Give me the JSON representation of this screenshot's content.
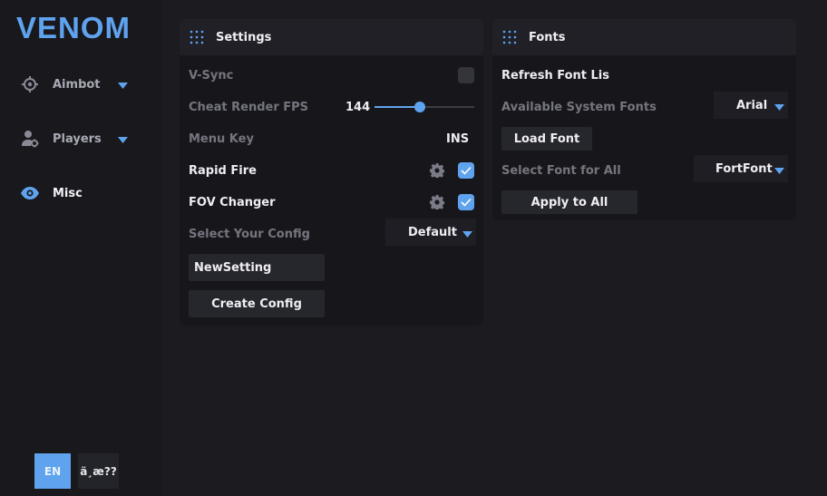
{
  "brand": {
    "name": "VENOM",
    "accent": "#5fa3ee"
  },
  "nav": [
    {
      "label": "Aimbot",
      "icon": "crosshair-icon",
      "expandable": true
    },
    {
      "label": "Players",
      "icon": "user-gear-icon",
      "expandable": true
    },
    {
      "label": "Misc",
      "icon": "eye-icon",
      "active": true
    }
  ],
  "languages": {
    "selected": "EN",
    "other": "ä¸­æ??"
  },
  "settings": {
    "title": "Settings",
    "vsync_label": "V-Sync",
    "vsync_checked": false,
    "fps_label": "Cheat Render FPS",
    "fps_value": "144",
    "fps_fill_fraction": 0.45,
    "menu_key_label": "Menu Key",
    "menu_key_value": "INS",
    "rapid_fire_label": "Rapid Fire",
    "rapid_fire_checked": true,
    "fov_label": "FOV Changer",
    "fov_checked": true,
    "config_label": "Select Your Config",
    "config_value": "Default",
    "config_name_input": "NewSetting",
    "create_config_label": "Create Config"
  },
  "fonts": {
    "title": "Fonts",
    "refresh_label": "Refresh Font Lis",
    "available_label": "Available System Fonts",
    "available_value": "Arial",
    "load_font_label": "Load Font",
    "select_all_label": "Select Font for All",
    "select_all_value": "FortFont",
    "apply_all_label": "Apply to All"
  }
}
